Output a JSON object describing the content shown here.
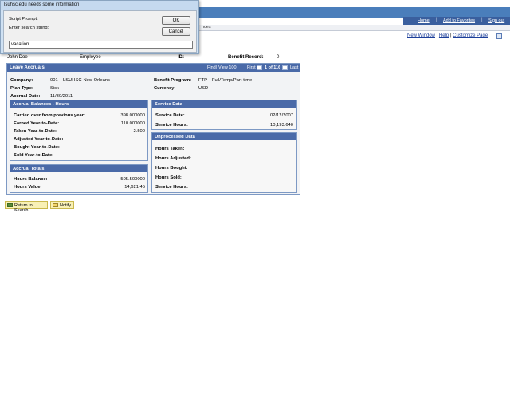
{
  "header": {
    "nav": [
      "Home",
      "Add to Favorites",
      "Sign out"
    ],
    "tab_fragment": "nces",
    "links": [
      "New Window",
      "Help",
      "Customize Page"
    ]
  },
  "employee": {
    "name": "John Doe",
    "type": "Employee",
    "id_label": "ID:",
    "record_label": "Benefit Record:",
    "record_value": "0"
  },
  "leave_accruals": {
    "title": "Leave Accruals",
    "pager": {
      "find": "Find",
      "view": "View 100",
      "first": "First",
      "count": "1 of 116",
      "last": "Last"
    },
    "company_label": "Company:",
    "company_code": "001",
    "company_name": "LSUHSC-New Orleans",
    "plan_type_label": "Plan Type:",
    "plan_type_value": "Sick",
    "accrual_date_label": "Accrual Date:",
    "accrual_date_value": "11/30/2011",
    "benefit_program_label": "Benefit Program:",
    "benefit_program_code": "FTP",
    "benefit_program_name": "Full/Temp/Part-time",
    "currency_label": "Currency:",
    "currency_value": "USD",
    "balances": {
      "title": "Accrual Balances - Hours",
      "rows": [
        {
          "label": "Carried over from previous year:",
          "value": "398.000000"
        },
        {
          "label": "Earned Year-to-Date:",
          "value": "110.000000"
        },
        {
          "label": "Taken Year-to-Date:",
          "value": "2.500"
        },
        {
          "label": "Adjusted Year-to-Date:",
          "value": ""
        },
        {
          "label": "Bought Year-to-Date:",
          "value": ""
        },
        {
          "label": "Sold Year-to-Date:",
          "value": ""
        }
      ]
    },
    "totals": {
      "title": "Accrual Totals",
      "rows": [
        {
          "label": "Hours Balance:",
          "value": "505.500000"
        },
        {
          "label": "Hours Value:",
          "value": "14,621.45"
        }
      ]
    },
    "service": {
      "title": "Service Data",
      "rows": [
        {
          "label": "Service Date:",
          "value": "02/12/2007"
        },
        {
          "label": "Service Hours:",
          "value": "10,193.640"
        }
      ]
    },
    "unprocessed": {
      "title": "Unprocessed Data",
      "rows": [
        "Hours Taken:",
        "Hours Adjusted:",
        "Hours Bought:",
        "Hours Sold:",
        "Service Hours:"
      ]
    }
  },
  "buttons": {
    "return": "Return to Search",
    "notify": "Notify"
  },
  "dialog": {
    "title": "lsuhsc.edu needs some information",
    "script_prompt": "Script Prompt:",
    "prompt_text": "Enter search string:",
    "ok": "OK",
    "cancel": "Cancel",
    "input_value": "vacation"
  },
  "colors": {
    "header_blue": "#4a7ebb",
    "panel_title": "#4a6aa8",
    "link": "#1c3e9a",
    "button_yellow": "#f8f0b6"
  }
}
